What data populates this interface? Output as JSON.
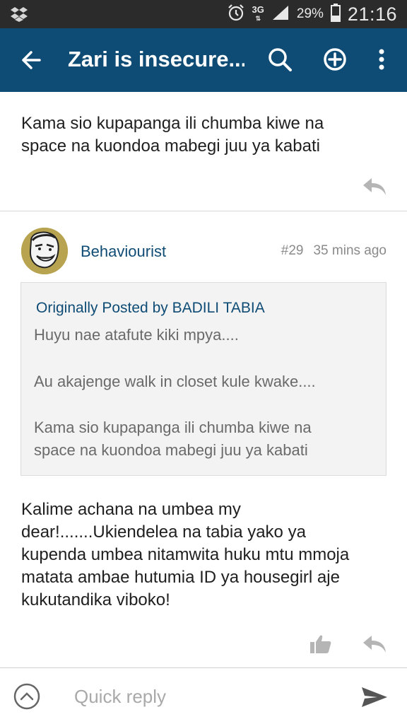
{
  "status_bar": {
    "network": "3G",
    "battery": "29%",
    "time": "21:16"
  },
  "app_bar": {
    "title": "Zari is insecure..."
  },
  "previous_post": {
    "body_lines": [
      "Kama sio kupapanga ili chumba kiwe na",
      "space na kuondoa mabegi juu ya kabati"
    ]
  },
  "post": {
    "username": "Behaviourist",
    "number": "#29",
    "time": "35 mins ago",
    "quote": {
      "header": "Originally Posted by BADILI TABIA",
      "lines": [
        "Huyu nae atafute kiki mpya....",
        "Au akajenge walk in closet kule kwake....",
        "Kama sio kupapanga ili chumba kiwe na",
        "space na kuondoa mabegi juu ya kabati"
      ]
    },
    "body_lines": [
      "Kalime achana na umbea my",
      "dear!.......Ukiendelea na tabia yako ya",
      "kupenda umbea nitamwita huku mtu mmoja",
      "matata ambae hutumia ID ya housegirl aje",
      "kukutandika viboko!"
    ]
  },
  "quick_reply": {
    "placeholder": "Quick reply"
  },
  "colors": {
    "app_bar": "#0f4c75",
    "status_bar": "#2b2b2b",
    "link": "#0f4c75"
  }
}
